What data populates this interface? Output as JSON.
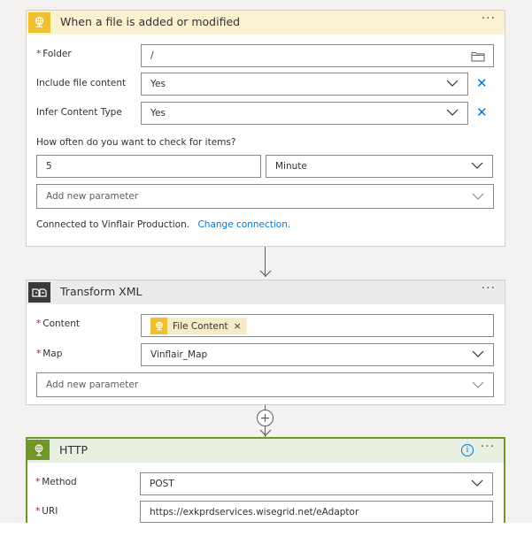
{
  "trigger": {
    "title": "When a file is added or modified",
    "more": "···",
    "folder": {
      "label": "Folder",
      "value": "/"
    },
    "include_file_content": {
      "label": "Include file content",
      "value": "Yes"
    },
    "infer_content_type": {
      "label": "Infer Content Type",
      "value": "Yes"
    },
    "frequency_label": "How often do you want to check for items?",
    "interval": "5",
    "unit": "Minute",
    "add_param": "Add new parameter",
    "connected_text": "Connected to Vinflair Production.",
    "change_connection": "Change connection.",
    "icon": "file-sync-icon",
    "color": "#f9f1d0"
  },
  "transform": {
    "title": "Transform XML",
    "more": "···",
    "content_label": "Content",
    "token_label": "File Content",
    "token_remove": "×",
    "map_label": "Map",
    "map_value": "Vinflair_Map",
    "add_param": "Add new parameter",
    "icon": "transform-icon",
    "color": "#ebebeb"
  },
  "insert_step": "+",
  "http": {
    "title": "HTTP",
    "info": "i",
    "more": "···",
    "method_label": "Method",
    "method_value": "POST",
    "uri_label": "URI",
    "uri_value": "https://exkprdservices.wisegrid.net/eAdaptor",
    "icon": "globe-icon",
    "color": "#e8f1e1",
    "accent": "#709727"
  }
}
